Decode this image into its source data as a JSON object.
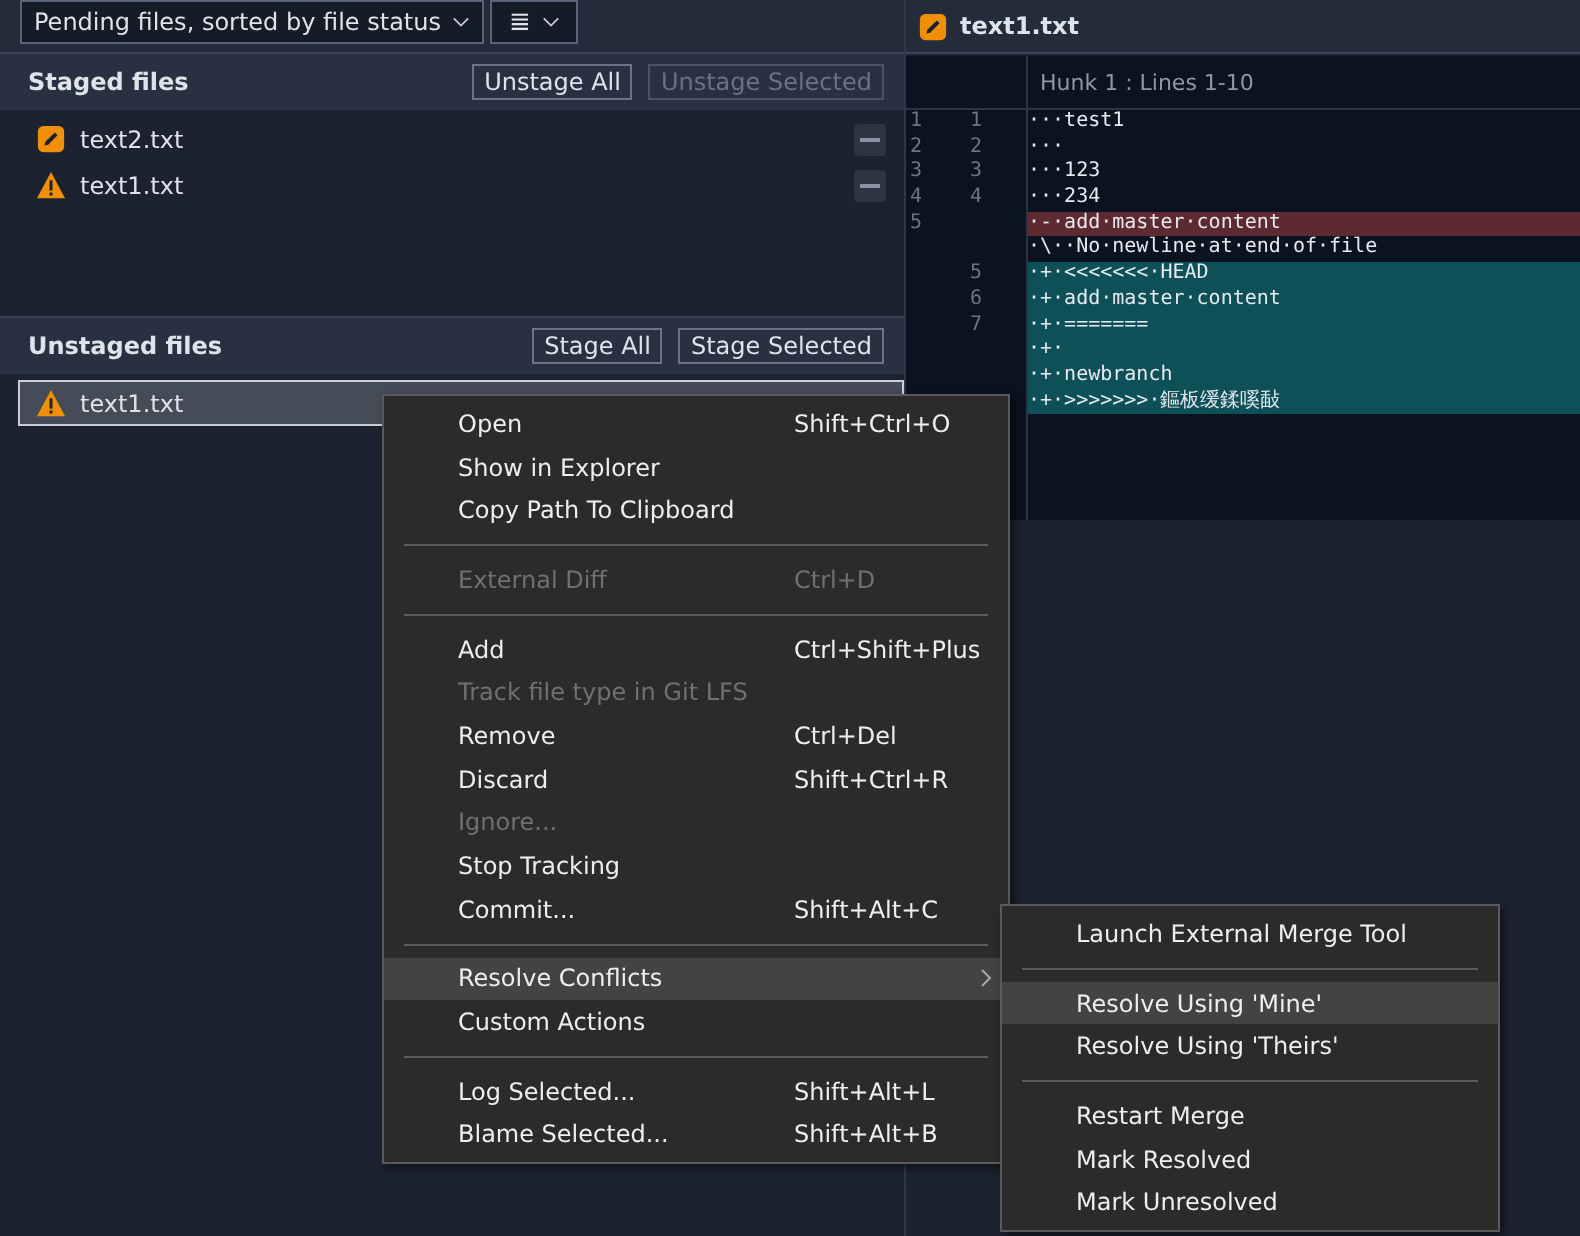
{
  "toolbar": {
    "view_dropdown": "Pending files, sorted by file status",
    "list_button": "≣"
  },
  "staged": {
    "title": "Staged files",
    "buttons": [
      {
        "label": "Unstage All",
        "disabled": false
      },
      {
        "label": "Unstage Selected",
        "disabled": true
      }
    ],
    "files": [
      {
        "name": "text2.txt",
        "kind": "modified",
        "selected": false
      },
      {
        "name": "text1.txt",
        "kind": "conflict",
        "selected": false
      }
    ]
  },
  "unstaged": {
    "title": "Unstaged files",
    "buttons": [
      {
        "label": "Stage All",
        "disabled": false
      },
      {
        "label": "Stage Selected",
        "disabled": false
      }
    ],
    "files": [
      {
        "name": "text1.txt",
        "kind": "conflict",
        "selected": true
      }
    ]
  },
  "diff": {
    "file": "text1.txt",
    "hunk": "Hunk 1 : Lines 1-10",
    "lines": [
      {
        "kind": "context",
        "old": "1",
        "new": "1",
        "text": "···test1"
      },
      {
        "kind": "context",
        "old": "2",
        "new": "2",
        "text": "···"
      },
      {
        "kind": "context",
        "old": "3",
        "new": "3",
        "text": "···123"
      },
      {
        "kind": "context",
        "old": "4",
        "new": "4",
        "text": "···234"
      },
      {
        "kind": "removed",
        "old": "5",
        "text": "·-·add·master·content"
      },
      {
        "kind": "context",
        "text": "·\\··No·newline·at·end·of·file"
      },
      {
        "kind": "added",
        "new": "5",
        "text": "·+·<<<<<<<·HEAD"
      },
      {
        "kind": "added",
        "new": "6",
        "text": "·+·add·master·content"
      },
      {
        "kind": "added",
        "new": "7",
        "text": "·+·======="
      },
      {
        "kind": "added",
        "text": "·+·"
      },
      {
        "kind": "added",
        "text": "·+·newbranch"
      },
      {
        "kind": "added",
        "text": "·+·>>>>>>>·鏂板缓鍒嗘敮"
      }
    ]
  },
  "context_menu": {
    "items": [
      {
        "kind": "item",
        "label": "Open",
        "shortcut": "Shift+Ctrl+O",
        "disabled": false,
        "selected": false
      },
      {
        "kind": "item",
        "label": "Show in Explorer",
        "disabled": false,
        "selected": false
      },
      {
        "kind": "item",
        "label": "Copy Path To Clipboard",
        "disabled": false,
        "selected": false
      },
      {
        "kind": "separator"
      },
      {
        "kind": "item",
        "label": "External Diff",
        "shortcut": "Ctrl+D",
        "disabled": true,
        "selected": false
      },
      {
        "kind": "separator"
      },
      {
        "kind": "item",
        "label": "Add",
        "shortcut": "Ctrl+Shift+Plus",
        "disabled": false,
        "selected": false
      },
      {
        "kind": "item",
        "label": "Track file type in Git LFS",
        "disabled": true,
        "selected": false
      },
      {
        "kind": "item",
        "label": "Remove",
        "shortcut": "Ctrl+Del",
        "disabled": false,
        "selected": false
      },
      {
        "kind": "item",
        "label": "Discard",
        "shortcut": "Shift+Ctrl+R",
        "disabled": false,
        "selected": false
      },
      {
        "kind": "item",
        "label": "Ignore...",
        "disabled": true,
        "selected": false
      },
      {
        "kind": "item",
        "label": "Stop Tracking",
        "disabled": false,
        "selected": false
      },
      {
        "kind": "item",
        "label": "Commit...",
        "shortcut": "Shift+Alt+C",
        "disabled": false,
        "selected": false
      },
      {
        "kind": "separator"
      },
      {
        "kind": "submenu",
        "label": "Resolve Conflicts",
        "disabled": false,
        "selected": true
      },
      {
        "kind": "item",
        "label": "Custom Actions",
        "disabled": false,
        "selected": false
      },
      {
        "kind": "separator"
      },
      {
        "kind": "item",
        "label": "Log Selected...",
        "shortcut": "Shift+Alt+L",
        "disabled": false,
        "selected": false
      },
      {
        "kind": "item",
        "label": "Blame Selected...",
        "shortcut": "Shift+Alt+B",
        "disabled": false,
        "selected": false
      }
    ]
  },
  "submenu": {
    "items": [
      {
        "kind": "item",
        "label": "Launch External Merge Tool",
        "selected": false
      },
      {
        "kind": "separator"
      },
      {
        "kind": "item",
        "label": "Resolve Using 'Mine'",
        "selected": true
      },
      {
        "kind": "item",
        "label": "Resolve Using 'Theirs'",
        "selected": false
      },
      {
        "kind": "separator"
      },
      {
        "kind": "item",
        "label": "Restart Merge",
        "selected": false
      },
      {
        "kind": "item",
        "label": "Mark Resolved",
        "selected": false
      },
      {
        "kind": "item",
        "label": "Mark Unresolved",
        "selected": false
      }
    ]
  }
}
